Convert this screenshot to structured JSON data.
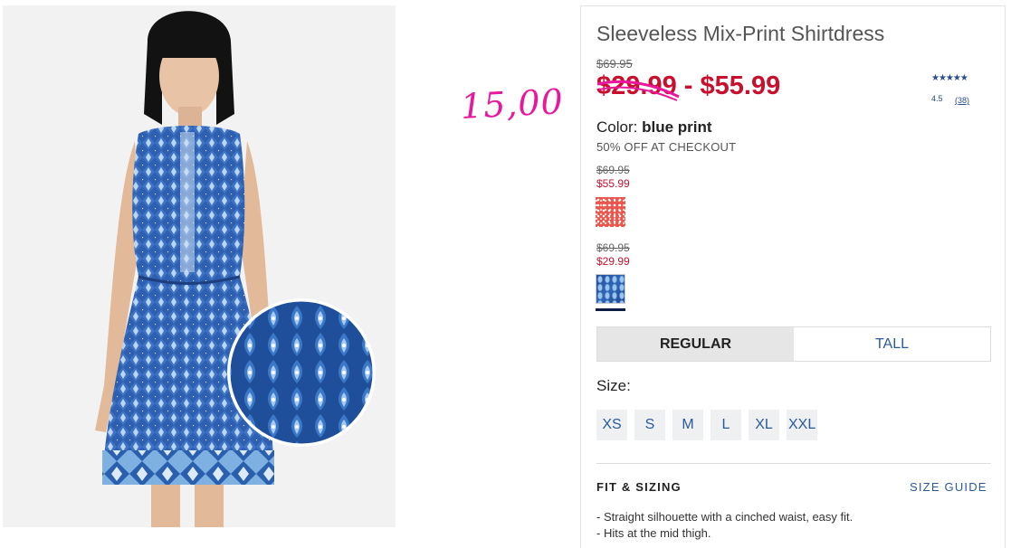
{
  "annotation": "15,00",
  "product": {
    "title": "Sleeveless Mix-Print Shirtdress",
    "original_price": "$69.95",
    "sale_price_low": "$29.99",
    "price_separator": "-",
    "sale_price_high": "$55.99",
    "rating": "4.5",
    "stars": "★★★★★",
    "review_count": "(38)"
  },
  "color": {
    "label": "Color:",
    "value": "blue print",
    "promo": "50% OFF AT CHECKOUT",
    "swatches": [
      {
        "orig": "$69.95",
        "sale": "$55.99",
        "name": "red print"
      },
      {
        "orig": "$69.95",
        "sale": "$29.99",
        "name": "blue print",
        "selected": true
      }
    ]
  },
  "fit_tabs": [
    {
      "label": "REGULAR",
      "active": true
    },
    {
      "label": "TALL",
      "active": false
    }
  ],
  "size": {
    "label": "Size:",
    "options": [
      "XS",
      "S",
      "M",
      "L",
      "XL",
      "XXL"
    ]
  },
  "fit_sizing": {
    "heading": "FIT & SIZING",
    "guide_link": "SIZE GUIDE",
    "details": [
      "- Straight silhouette with a cinched waist, easy fit.",
      "- Hits at the mid thigh."
    ]
  },
  "colors": {
    "sale_red": "#c8102e",
    "link_blue": "#2a5a9a",
    "annotation_pink": "#e8179b"
  }
}
